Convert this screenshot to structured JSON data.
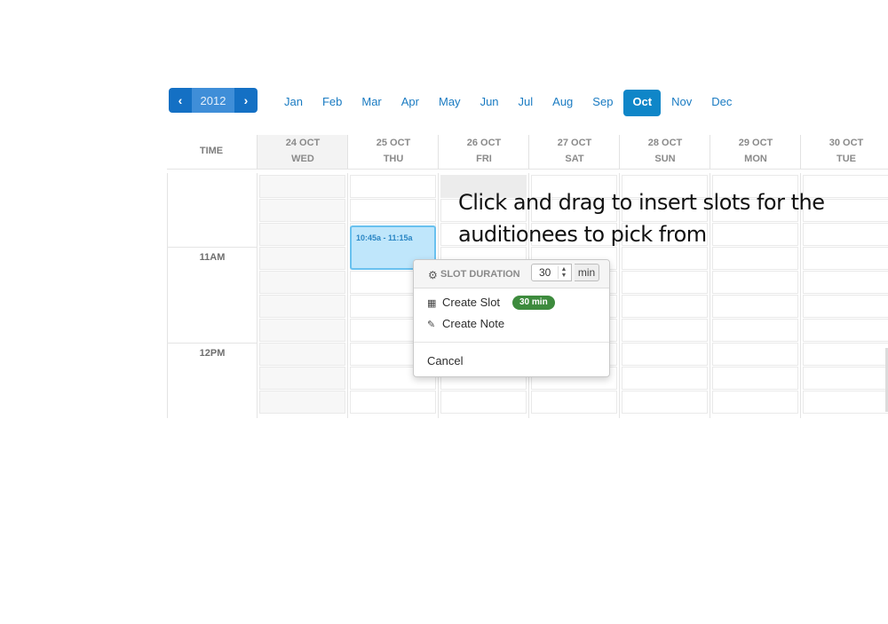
{
  "year_nav": {
    "prev_icon": "chevron-left-icon",
    "year": "2012",
    "next_icon": "chevron-right-icon",
    "prev_glyph": "‹",
    "next_glyph": "›"
  },
  "months": [
    "Jan",
    "Feb",
    "Mar",
    "Apr",
    "May",
    "Jun",
    "Jul",
    "Aug",
    "Sep",
    "Oct",
    "Nov",
    "Dec"
  ],
  "active_month": "Oct",
  "calendar": {
    "time_header": "TIME",
    "days": [
      {
        "date": "24 OCT",
        "weekday": "WED"
      },
      {
        "date": "25 OCT",
        "weekday": "THU"
      },
      {
        "date": "26 OCT",
        "weekday": "FRI"
      },
      {
        "date": "27 OCT",
        "weekday": "SAT"
      },
      {
        "date": "28 OCT",
        "weekday": "SUN"
      },
      {
        "date": "29 OCT",
        "weekday": "MON"
      },
      {
        "date": "30 OCT",
        "weekday": "TUE"
      }
    ],
    "time_labels": [
      "11AM",
      "12PM"
    ]
  },
  "event": {
    "time_range": "10:45a - 11:15a"
  },
  "popover": {
    "title": "SLOT DURATION",
    "duration_value": "30",
    "duration_unit": "min",
    "create_slot_label": "Create Slot",
    "create_slot_badge": "30 min",
    "create_note_label": "Create Note",
    "cancel_label": "Cancel",
    "icons": {
      "gear": "gear-icon",
      "calendar": "calendar-icon",
      "pencil": "pencil-icon"
    }
  },
  "annotation": {
    "line1": "Click and drag to insert slots for the",
    "line2": "auditionees to pick from"
  },
  "colors": {
    "primary_blue": "#1470c4",
    "active_month": "#0f86c8",
    "event_fill": "#bfe6fb",
    "event_border": "#69c1ef",
    "badge_green": "#3d8b3d"
  }
}
